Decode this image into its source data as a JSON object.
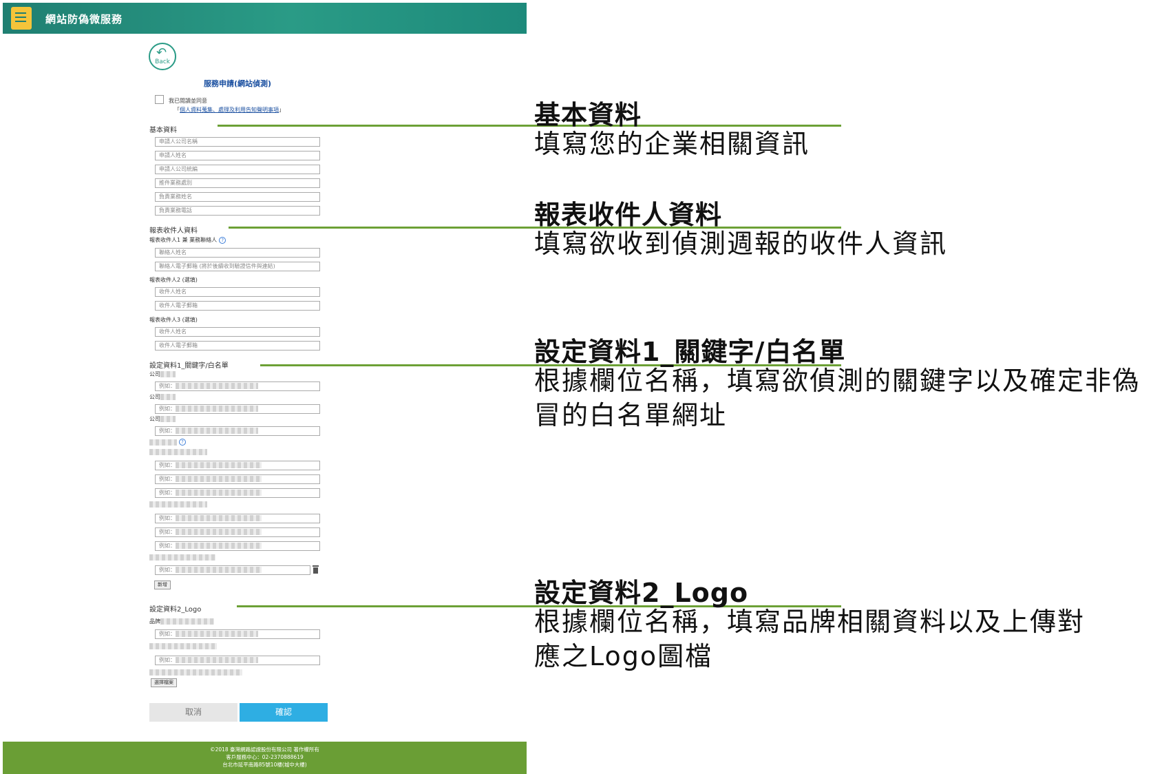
{
  "header": {
    "title": "網站防偽微服務"
  },
  "form": {
    "back_label": "Back",
    "title": "服務申請(網站偵測)",
    "agree_text": "我已閱讀並同意",
    "agree_link_prefix": "「",
    "agree_link": "個人資料蒐集、處理及利用告知聲明事項",
    "agree_link_suffix": "」",
    "basic": {
      "label": "基本資料",
      "fields": [
        "申請人公司名稱",
        "申請人姓名",
        "申請人公司統編",
        "推件業務處別",
        "負責業務姓名",
        "負責業務電話"
      ]
    },
    "report": {
      "label": "報表收件人資料",
      "r1_label": "報表收件人1 兼 業務聯絡人",
      "r1_fields": [
        "聯絡人姓名",
        "聯絡人電子郵箱 (將於後續收到驗證信件與連結)"
      ],
      "r2_label": "報表收件人2 (選填)",
      "r2_fields": [
        "收件人姓名",
        "收件人電子郵箱"
      ],
      "r3_label": "報表收件人3 (選填)",
      "r3_fields": [
        "收件人姓名",
        "收件人電子郵箱"
      ]
    },
    "setting1": {
      "label": "設定資料1_關鍵字/白名單",
      "company_label": "公司",
      "example_prefix": "例如：",
      "add_button": "新增"
    },
    "setting2": {
      "label": "設定資料2_Logo",
      "brand_label": "品牌",
      "example_prefix": "例如：",
      "upload_button": "選擇檔案"
    },
    "cancel_button": "取消",
    "confirm_button": "確認"
  },
  "footer": {
    "line1": "©2018 臺灣網路認證股份有限公司 著作權所有",
    "line2": "客戶服務中心：02-2370888619",
    "line3": "台北市延平南路85號10樓(城中大樓)"
  },
  "annotations": [
    {
      "heading": "基本資料",
      "desc": [
        "填寫您的企業相關資訊"
      ]
    },
    {
      "heading": "報表收件人資料",
      "desc": [
        "填寫欲收到偵測週報的收件人資訊"
      ]
    },
    {
      "heading": "設定資料1_關鍵字/白名單",
      "desc": [
        "根據欄位名稱，填寫欲偵測的關鍵字以及確定非偽",
        "冒的白名單網址"
      ]
    },
    {
      "heading": "設定資料2_Logo",
      "desc": [
        "根據欄位名稱，填寫品牌相關資料以及上傳對",
        "應之Logo圖檔"
      ]
    }
  ],
  "colors": {
    "header": "#2a9b86",
    "footer": "#6a9e35",
    "confirm": "#2eaee3",
    "annotation_line": "#6ca035"
  }
}
